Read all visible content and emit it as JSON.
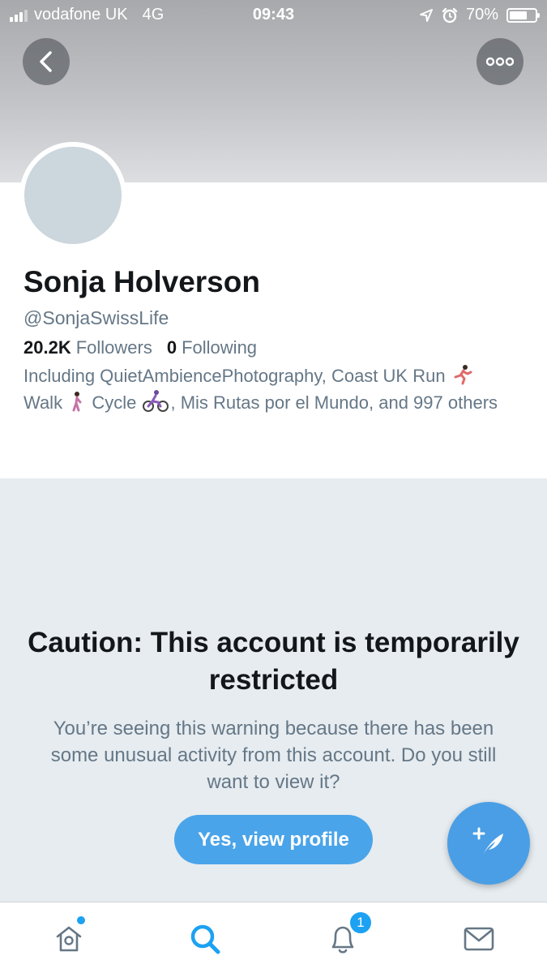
{
  "status_bar": {
    "carrier": "vodafone UK",
    "network": "4G",
    "time": "09:43",
    "battery_percent": "70%",
    "battery_level": 0.7
  },
  "profile": {
    "name": "Sonja Holverson",
    "handle": "@SonjaSwissLife",
    "followers_count": "20.2K",
    "followers_label": "Followers",
    "following_count": "0",
    "following_label": "Following",
    "followed_by": {
      "part1": "Including QuietAmbiencePhotography, Coast UK Run",
      "part2": "Walk",
      "part3": "Cycle",
      "part4": ", Mis Rutas por el Mundo, and 997 others"
    }
  },
  "warning": {
    "title": "Caution: This account is temporarily restricted",
    "body": "You’re seeing this warning because there has been some unusual activity from this account. Do you still want to view it?",
    "button_label": "Yes, view profile"
  },
  "tabbar": {
    "notifications_badge": "1",
    "items": [
      "home-icon",
      "search-icon",
      "bell-icon",
      "mail-icon"
    ]
  },
  "colors": {
    "accent": "#1da1f2",
    "button": "#4aa4e9",
    "panel_bg": "#e6ecf0"
  }
}
